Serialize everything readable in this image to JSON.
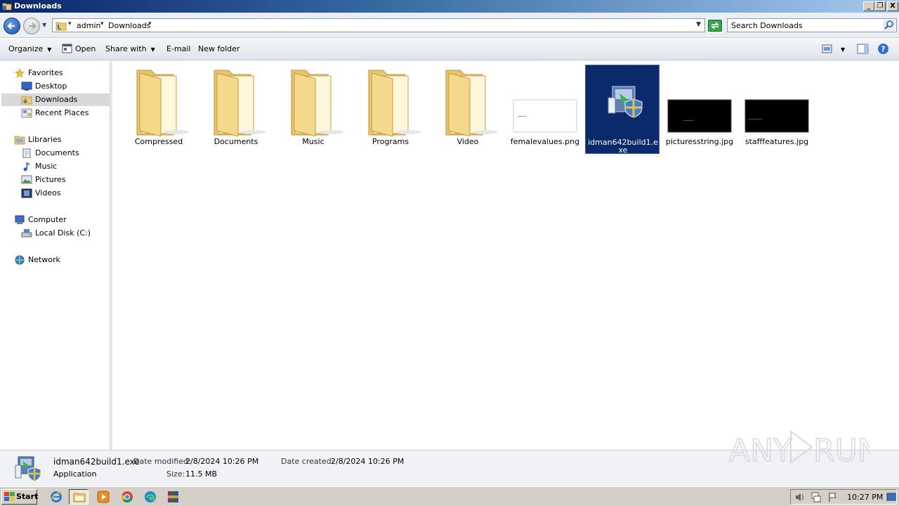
{
  "window": {
    "title": "Downloads",
    "controls": [
      "_",
      "❐",
      "X"
    ]
  },
  "address": {
    "crumbs": [
      "admin",
      "Downloads"
    ],
    "search_placeholder": "Search Downloads"
  },
  "toolbar": {
    "organize": "Organize",
    "open": "Open",
    "share_with": "Share with",
    "email": "E-mail",
    "new_folder": "New folder"
  },
  "nav": {
    "favorites": {
      "label": "Favorites",
      "items": [
        {
          "label": "Desktop",
          "icon": "desktop-icon"
        },
        {
          "label": "Downloads",
          "icon": "downloads-folder-icon",
          "selected": true
        },
        {
          "label": "Recent Places",
          "icon": "recent-places-icon"
        }
      ]
    },
    "libraries": {
      "label": "Libraries",
      "items": [
        {
          "label": "Documents",
          "icon": "documents-icon"
        },
        {
          "label": "Music",
          "icon": "music-icon"
        },
        {
          "label": "Pictures",
          "icon": "pictures-icon"
        },
        {
          "label": "Videos",
          "icon": "videos-icon"
        }
      ]
    },
    "computer": {
      "label": "Computer",
      "items": [
        {
          "label": "Local Disk (C:)",
          "icon": "local-disk-icon"
        }
      ]
    },
    "network": {
      "label": "Network"
    }
  },
  "files": [
    {
      "name": "Compressed",
      "type": "folder"
    },
    {
      "name": "Documents",
      "type": "folder"
    },
    {
      "name": "Music",
      "type": "folder"
    },
    {
      "name": "Programs",
      "type": "folder"
    },
    {
      "name": "Video",
      "type": "folder"
    },
    {
      "name": "femalevalues.png",
      "type": "image-white"
    },
    {
      "name": "idman642build1.exe",
      "type": "installer",
      "selected": true
    },
    {
      "name": "picturesstring.jpg",
      "type": "image-black"
    },
    {
      "name": "stafffeatures.jpg",
      "type": "image-black"
    }
  ],
  "details": {
    "filename": "idman642build1.exe",
    "filetype": "Application",
    "date_modified_label": "Date modified:",
    "date_modified": "2/8/2024 10:26 PM",
    "date_created_label": "Date created:",
    "date_created": "2/8/2024 10:26 PM",
    "size_label": "Size:",
    "size": "11.5 MB"
  },
  "watermark": "ANY RUN",
  "taskbar": {
    "start": "Start",
    "apps": [
      "internet-explorer-icon",
      "windows-explorer-icon",
      "media-player-icon",
      "chrome-icon",
      "edge-icon",
      "winrar-icon"
    ],
    "clock": "10:27 PM"
  },
  "colors": {
    "selection": "#0b2a6b",
    "title_gradient_start": "#0a246a",
    "folder": "#f2d27a"
  }
}
